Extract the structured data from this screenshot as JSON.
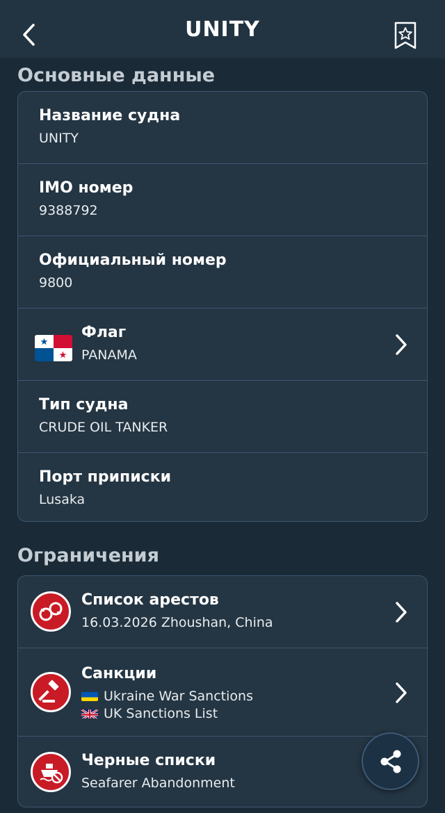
{
  "header": {
    "title": "UNITY"
  },
  "main_section": {
    "title": "Основные данные",
    "rows": [
      {
        "label": "Название судна",
        "value": "UNITY"
      },
      {
        "label": "IMO номер",
        "value": "9388792"
      },
      {
        "label": "Официальный номер",
        "value": "9800"
      },
      {
        "label": "Флаг",
        "value": "PANAMA"
      },
      {
        "label": "Тип судна",
        "value": "CRUDE OIL TANKER"
      },
      {
        "label": "Порт приписки",
        "value": "Lusaka"
      }
    ]
  },
  "restrictions_section": {
    "title": "Ограничения",
    "arrests": {
      "label": "Список арестов",
      "value": "16.03.2026 Zhoushan, China"
    },
    "sanctions": {
      "label": "Санкции",
      "items": [
        "Ukraine War Sanctions",
        "UK Sanctions List"
      ]
    },
    "blacklists": {
      "label": "Черные списки",
      "value": "Seafarer Abandonment"
    }
  },
  "colors": {
    "background": "#1a2a36",
    "header": "#223442",
    "card": "#243543",
    "border": "#3d5770",
    "alert_red": "#c81b26"
  },
  "icons": {
    "back": "chevron-left-icon",
    "bookmark": "bookmark-star-icon",
    "arrests": "handcuffs-icon",
    "sanctions": "gavel-icon",
    "blacklists": "ship-prohibited-icon",
    "share": "share-icon"
  }
}
